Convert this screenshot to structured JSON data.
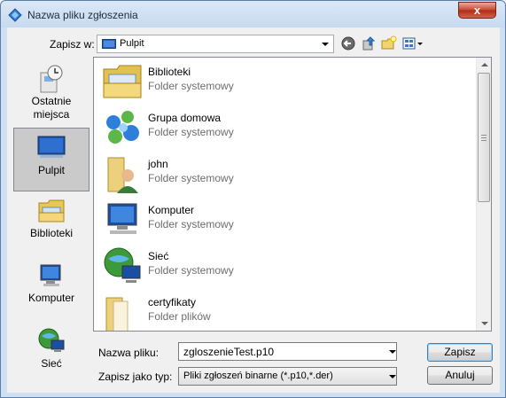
{
  "window": {
    "title": "Nazwa pliku zgłoszenia",
    "close_glyph": "x"
  },
  "toolbar": {
    "save_in_label": "Zapisz w:",
    "location": "Pulpit",
    "buttons": [
      "back-icon",
      "up-folder-icon",
      "new-folder-icon",
      "view-menu-icon"
    ]
  },
  "places": [
    {
      "label": "Ostatnie miejsca",
      "icon": "recent-places-icon"
    },
    {
      "label": "Pulpit",
      "icon": "desktop-icon",
      "selected": true
    },
    {
      "label": "Biblioteki",
      "icon": "libraries-icon"
    },
    {
      "label": "Komputer",
      "icon": "computer-icon"
    },
    {
      "label": "Sieć",
      "icon": "network-icon"
    }
  ],
  "files": [
    {
      "name": "Biblioteki",
      "type": "Folder systemowy",
      "icon": "libraries-icon"
    },
    {
      "name": "Grupa domowa",
      "type": "Folder systemowy",
      "icon": "homegroup-icon"
    },
    {
      "name": "john",
      "type": "Folder systemowy",
      "icon": "user-folder-icon"
    },
    {
      "name": "Komputer",
      "type": "Folder systemowy",
      "icon": "computer-icon"
    },
    {
      "name": "Sieć",
      "type": "Folder systemowy",
      "icon": "network-icon"
    },
    {
      "name": "certyfikaty",
      "type": "Folder plików",
      "icon": "folder-icon"
    }
  ],
  "form": {
    "filename_label": "Nazwa pliku:",
    "filename_value": "zgloszenieTest.p10",
    "filetype_label": "Zapisz jako typ:",
    "filetype_value": "Pliki zgłoszeń binarne (*.p10,*.der)"
  },
  "buttons": {
    "save": "Zapisz",
    "cancel": "Anuluj"
  },
  "colors": {
    "title_bar": "#c7daf0",
    "close_button": "#c7452f",
    "selection": "#cacaca"
  }
}
